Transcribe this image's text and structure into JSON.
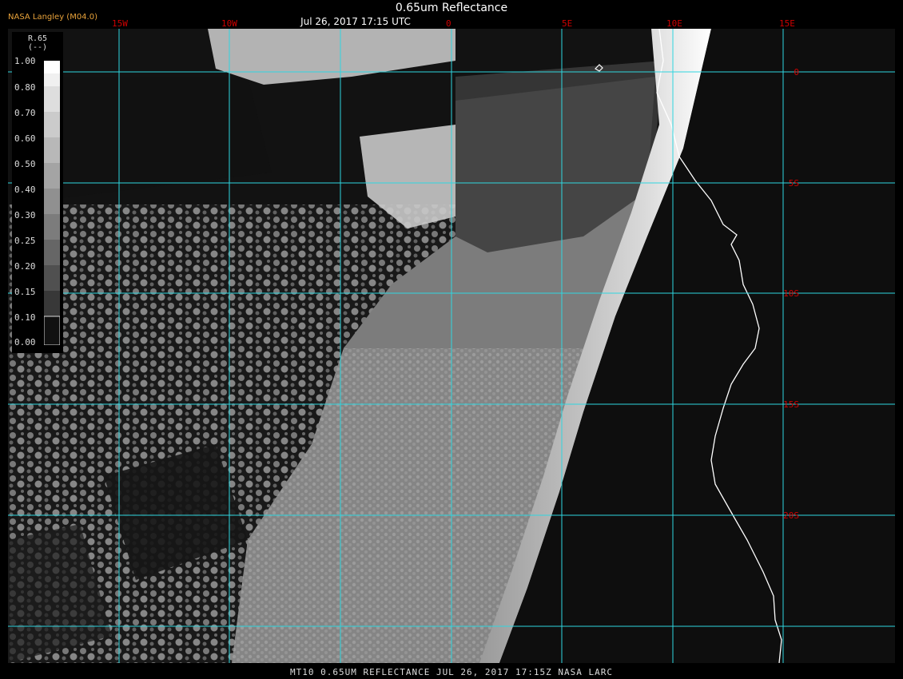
{
  "header": {
    "title": "0.65um Reflectance",
    "time": "Jul 26, 2017 17:15 UTC",
    "agency": "NASA Langley (M04.0)"
  },
  "grid": {
    "lon_labels": [
      "15W",
      "10W",
      "0",
      "5E",
      "10E",
      "15E"
    ],
    "lat_labels": [
      "0",
      "5S",
      "10S",
      "15S",
      "20S"
    ],
    "line_color": "#2fd6e0",
    "label_color": "#d00000"
  },
  "legend": {
    "title": "R.65",
    "unit": "(--)",
    "ticks": [
      "1.00",
      "0.80",
      "0.70",
      "0.60",
      "0.50",
      "0.40",
      "0.30",
      "0.25",
      "0.20",
      "0.15",
      "0.10",
      "0.00"
    ]
  },
  "footer": {
    "text": "MT10  0.65UM REFLECTANCE   JUL 26, 2017 17:15Z   NASA LARC"
  },
  "colors": {
    "coastline": "#ffffff",
    "background": "#000000",
    "agency_text": "#e8a23a"
  }
}
